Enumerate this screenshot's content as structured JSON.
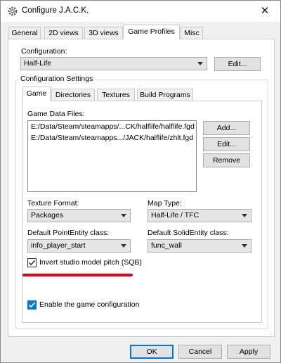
{
  "window": {
    "title": "Configure J.A.C.K.",
    "close_glyph": "✕"
  },
  "tabs": [
    {
      "label": "General"
    },
    {
      "label": "2D views"
    },
    {
      "label": "3D views"
    },
    {
      "label": "Game Profiles"
    },
    {
      "label": "Misc"
    }
  ],
  "configuration": {
    "label": "Configuration:",
    "value": "Half-Life",
    "edit_button": "Edit..."
  },
  "settings": {
    "group_label": "Configuration Settings",
    "subtabs": [
      {
        "label": "Game"
      },
      {
        "label": "Directories"
      },
      {
        "label": "Textures"
      },
      {
        "label": "Build Programs"
      }
    ],
    "game_data_files_label": "Game Data Files:",
    "files": [
      "E:/Data/Steam/steamapps/...CK/halflife/halflife.fgd",
      "E:/Data/Steam/steamapps.../JACK/halflife/zhlt.fgd"
    ],
    "add_button": "Add...",
    "edit_button": "Edit...",
    "remove_button": "Remove",
    "texture_format_label": "Texture Format:",
    "texture_format_value": "Packages",
    "map_type_label": "Map Type:",
    "map_type_value": "Half-Life / TFC",
    "point_entity_label": "Default PointEntity class:",
    "point_entity_value": "info_player_start",
    "solid_entity_label": "Default SolidEntity class:",
    "solid_entity_value": "func_wall",
    "invert_pitch_label": "Invert studio model pitch (SQB)",
    "invert_pitch_checked": true,
    "enable_config_label": "Enable the game configuration",
    "enable_config_checked": true
  },
  "footer": {
    "ok": "OK",
    "cancel": "Cancel",
    "apply": "Apply"
  },
  "colors": {
    "accent_blue": "#0078d7",
    "highlight_red": "#e8001c"
  }
}
